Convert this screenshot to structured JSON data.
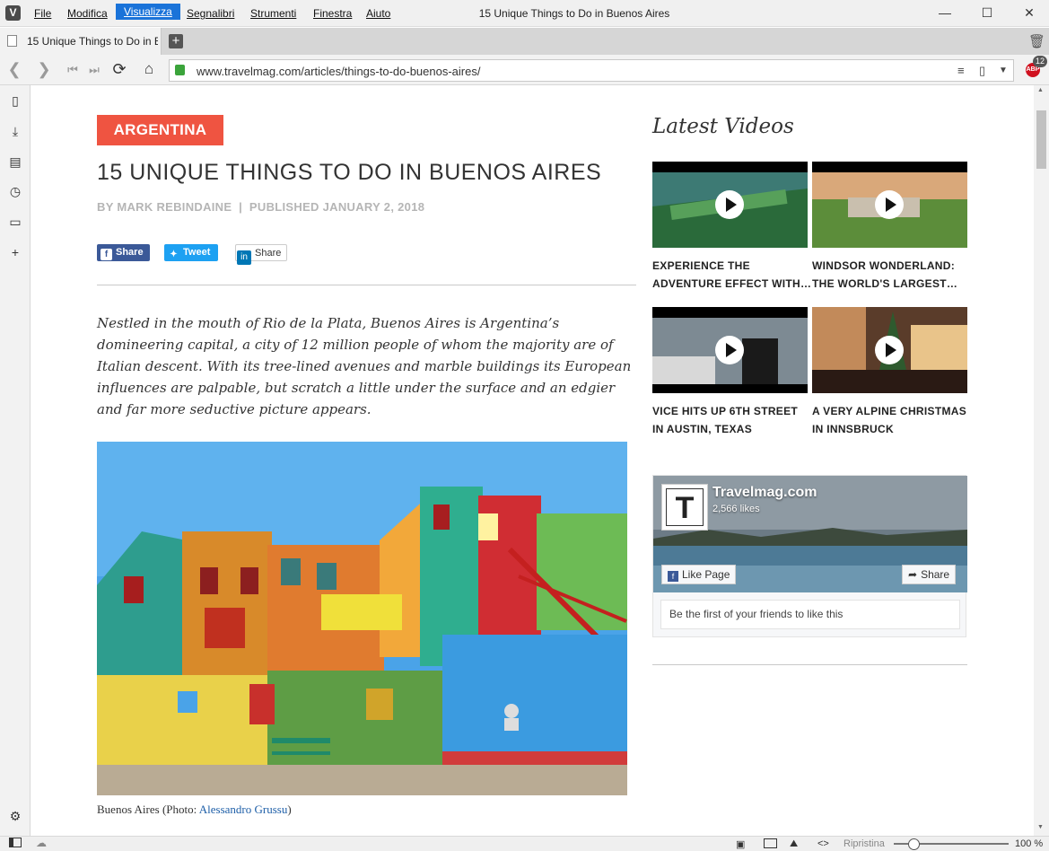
{
  "browser": {
    "window_title": "15 Unique Things to Do in Buenos Aires",
    "menu": [
      "File",
      "Modifica",
      "Visualizza",
      "Segnalibri",
      "Strumenti",
      "Finestra",
      "Aiuto"
    ],
    "active_menu": "Visualizza",
    "tab_title": "15 Unique Things to Do in Buenos Aires",
    "url": "www.travelmag.com/articles/things-to-do-buenos-aires/",
    "adblock_label": "ABP",
    "adblock_count": "12",
    "status": {
      "reset_label": "Ripristina",
      "zoom": "100 %"
    }
  },
  "article": {
    "category": "ARGENTINA",
    "headline": "15 UNIQUE THINGS TO DO IN BUENOS AIRES",
    "byline": "BY MARK REBINDAINE  |  PUBLISHED JANUARY 2, 2018",
    "share_buttons": {
      "facebook": "Share",
      "twitter": "Tweet",
      "linkedin": "Share"
    },
    "intro": "Nestled in the mouth of Rio de la Plata, Buenos Aires is Argentina’s domineering capital, a city of 12 million people of whom the majority are of Italian descent. With its tree-lined avenues and marble buildings its European influences are palpable, but scratch a little under the surface and an edgier and far more seductive picture appears.",
    "caption_prefix": "Buenos Aires (Photo: ",
    "caption_link": "Alessandro Grussu",
    "caption_suffix": ")"
  },
  "sidebar": {
    "heading": "Latest Videos",
    "videos": [
      {
        "line1": "EXPERIENCE THE",
        "line2": "ADVENTURE EFFECT WITH…"
      },
      {
        "line1": "WINDSOR WONDERLAND:",
        "line2": "THE WORLD'S LARGEST…"
      },
      {
        "line1": "VICE HITS UP 6TH STREET",
        "line2": "IN AUSTIN, TEXAS"
      },
      {
        "line1": "A VERY ALPINE CHRISTMAS",
        "line2": "IN INNSBRUCK"
      }
    ],
    "facebook": {
      "page_name": "Travelmag.com",
      "likes": "2,566 likes",
      "like_button": "Like Page",
      "share_button": "Share",
      "friends_text": "Be the first of your friends to like this"
    }
  },
  "colors": {
    "category_badge": "#ef5441",
    "facebook": "#3b5998",
    "twitter": "#1da1f2",
    "menu_active": "#1a73d9"
  }
}
